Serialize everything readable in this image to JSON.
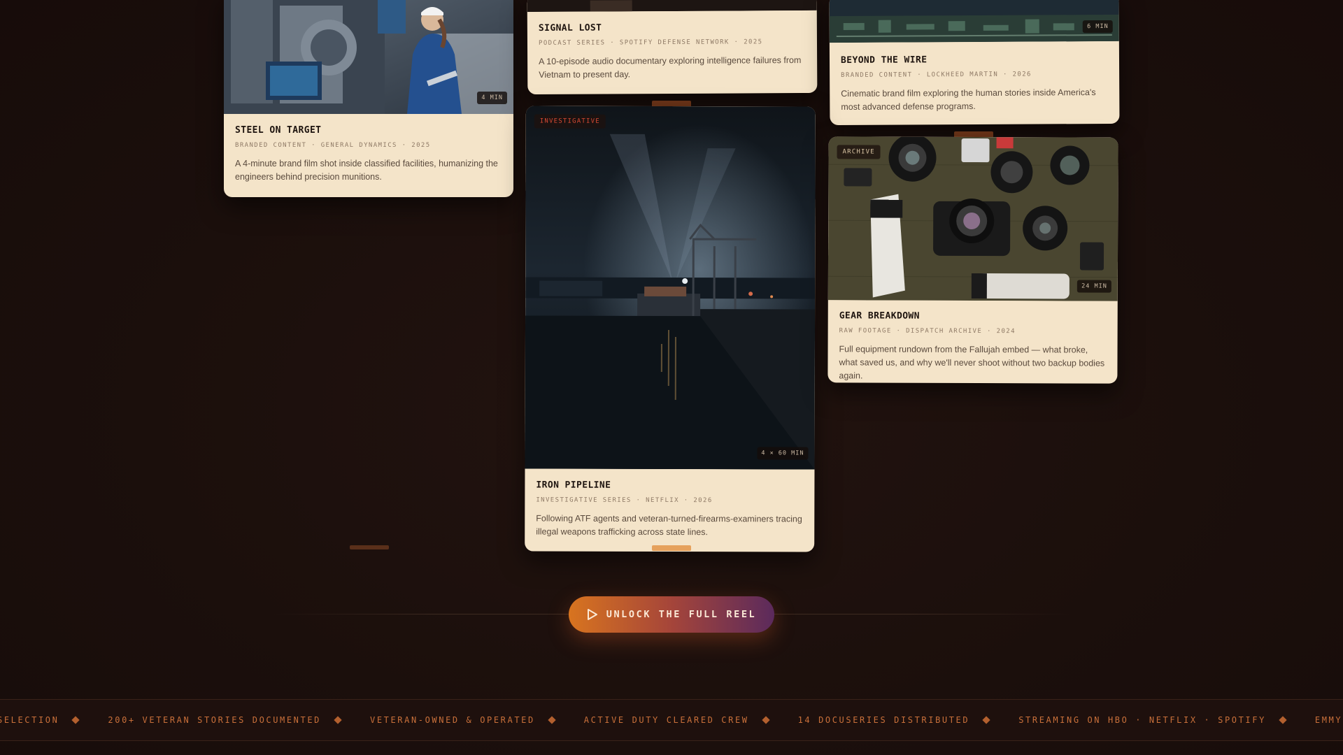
{
  "colors": {
    "accent": "#d8741f",
    "card_bg": "#f4e4c9",
    "page_bg": "#1c0f0c",
    "tag_red": "#d94a33",
    "tag_tan": "#d9c4a3"
  },
  "cards": {
    "steel": {
      "title": "STEEL ON TARGET",
      "meta": "BRANDED CONTENT · GENERAL DYNAMICS · 2025",
      "description": "A 4-minute brand film shot inside classified facilities, humanizing the engineers behind precision munitions.",
      "duration": "4 MIN"
    },
    "signal": {
      "title": "SIGNAL LOST",
      "meta": "PODCAST SERIES · SPOTIFY DEFENSE NETWORK · 2025",
      "description": "A 10-episode audio documentary exploring intelligence failures from Vietnam to present day."
    },
    "beyond": {
      "title": "BEYOND THE WIRE",
      "meta": "BRANDED CONTENT · LOCKHEED MARTIN · 2026",
      "description": "Cinematic brand film exploring the human stories inside America's most advanced defense programs.",
      "duration": "6 MIN"
    },
    "iron": {
      "tag": "INVESTIGATIVE",
      "title": "IRON PIPELINE",
      "meta": "INVESTIGATIVE SERIES · NETFLIX · 2026",
      "description": "Following ATF agents and veteran-turned-firearms-examiners tracing illegal weapons trafficking across state lines.",
      "duration": "4 × 60 MIN"
    },
    "gear": {
      "tag": "ARCHIVE",
      "title": "GEAR BREAKDOWN",
      "meta": "RAW FOOTAGE · DISPATCH ARCHIVE · 2024",
      "description": "Full equipment rundown from the Fallujah embed — what broke, what saved us, and why we'll never shoot without two backup bodies again.",
      "duration": "24 MIN"
    }
  },
  "cta": {
    "label": "UNLOCK THE FULL REEL",
    "icon": "play-icon"
  },
  "ticker": {
    "items": [
      "SELECTION",
      "200+ VETERAN STORIES DOCUMENTED",
      "VETERAN-OWNED & OPERATED",
      "ACTIVE DUTY CLEARED CREW",
      "14 DOCUSERIES DISTRIBUTED",
      "STREAMING ON HBO · NETFLIX · SPOTIFY",
      "EMMY NOMI"
    ],
    "separator_icon": "diamond-icon"
  }
}
